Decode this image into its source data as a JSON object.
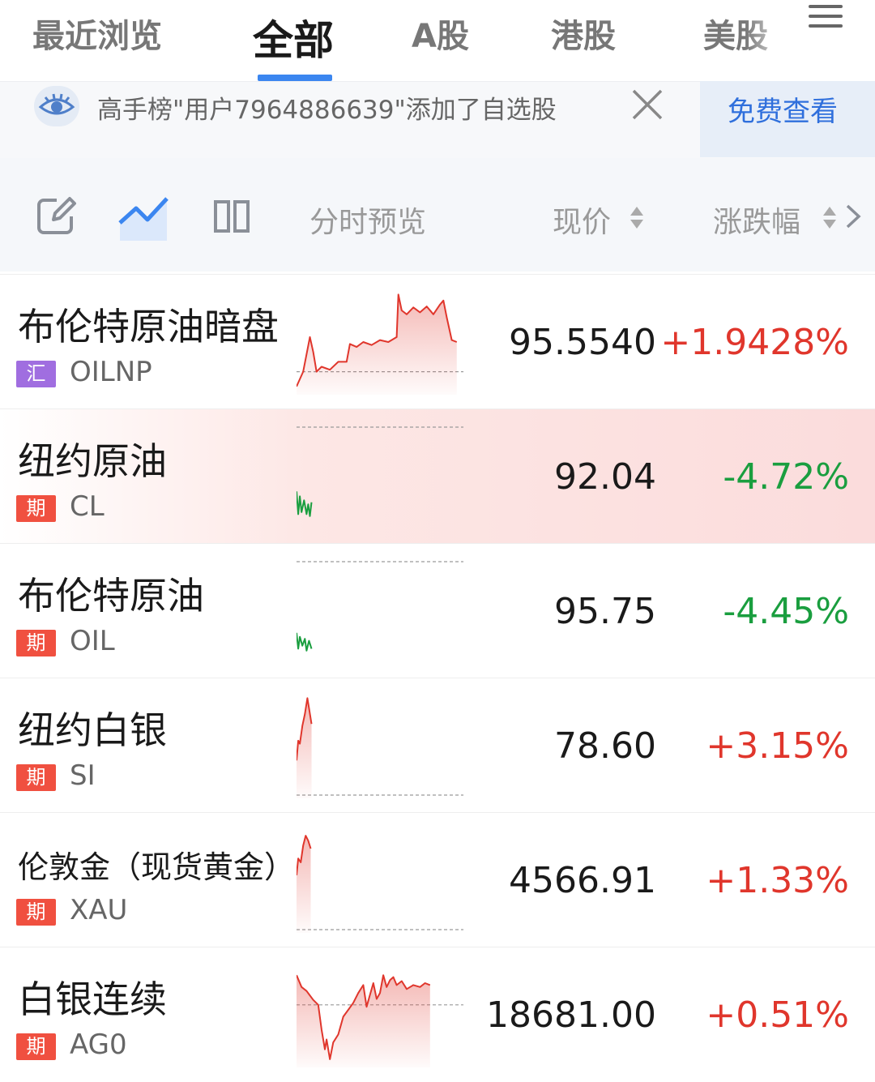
{
  "tabs": [
    {
      "label": "最近浏览",
      "active": false
    },
    {
      "label": "全部",
      "active": true
    },
    {
      "label": "A股",
      "active": false
    },
    {
      "label": "港股",
      "active": false
    },
    {
      "label": "美股",
      "active": false
    }
  ],
  "banner": {
    "text": "高手榜\"用户7964886639\"添加了自选股",
    "button_label": "免费查看"
  },
  "header": {
    "preview": "分时预览",
    "price": "现价",
    "change": "涨跌幅"
  },
  "colors": {
    "up": "#e0362c",
    "down": "#1a9e3f",
    "accent": "#3b86f0",
    "badge_futures": "#f05040",
    "badge_fx": "#a06ee0"
  },
  "rows": [
    {
      "name": "布伦特原油暗盘",
      "badge": "汇",
      "badge_type": "fx",
      "code": "OILNP",
      "price": "95.5540",
      "change": "+1.9428%",
      "direction": "up",
      "highlighted": false,
      "spark": [
        [
          0,
          0.05
        ],
        [
          0.04,
          0.2
        ],
        [
          0.08,
          0.55
        ],
        [
          0.1,
          0.4
        ],
        [
          0.12,
          0.2
        ],
        [
          0.15,
          0.25
        ],
        [
          0.2,
          0.22
        ],
        [
          0.25,
          0.3
        ],
        [
          0.3,
          0.3
        ],
        [
          0.32,
          0.48
        ],
        [
          0.36,
          0.45
        ],
        [
          0.4,
          0.5
        ],
        [
          0.45,
          0.47
        ],
        [
          0.5,
          0.52
        ],
        [
          0.55,
          0.5
        ],
        [
          0.6,
          0.55
        ],
        [
          0.61,
          0.98
        ],
        [
          0.63,
          0.82
        ],
        [
          0.66,
          0.78
        ],
        [
          0.7,
          0.85
        ],
        [
          0.74,
          0.8
        ],
        [
          0.78,
          0.86
        ],
        [
          0.82,
          0.78
        ],
        [
          0.86,
          0.88
        ],
        [
          0.88,
          0.92
        ],
        [
          0.9,
          0.75
        ],
        [
          0.93,
          0.52
        ],
        [
          0.96,
          0.5
        ]
      ],
      "spark_baseline": 0.2
    },
    {
      "name": "纽约原油",
      "badge": "期",
      "badge_type": "futures",
      "code": "CL",
      "price": "92.04",
      "change": "-4.72%",
      "direction": "down",
      "highlighted": true,
      "spark": [
        [
          0,
          0.35
        ],
        [
          0.01,
          0.12
        ],
        [
          0.02,
          0.3
        ],
        [
          0.03,
          0.14
        ],
        [
          0.045,
          0.26
        ],
        [
          0.06,
          0.12
        ],
        [
          0.07,
          0.22
        ],
        [
          0.08,
          0.1
        ],
        [
          0.09,
          0.24
        ]
      ],
      "spark_baseline": 1.0
    },
    {
      "name": "布伦特原油",
      "badge": "期",
      "badge_type": "futures",
      "code": "OIL",
      "price": "95.75",
      "change": "-4.45%",
      "direction": "down",
      "highlighted": false,
      "spark": [
        [
          0,
          0.28
        ],
        [
          0.01,
          0.12
        ],
        [
          0.02,
          0.24
        ],
        [
          0.035,
          0.15
        ],
        [
          0.05,
          0.22
        ],
        [
          0.06,
          0.1
        ],
        [
          0.075,
          0.2
        ],
        [
          0.09,
          0.12
        ]
      ],
      "spark_baseline": 1.0
    },
    {
      "name": "纽约白银",
      "badge": "期",
      "badge_type": "futures",
      "code": "SI",
      "price": "78.60",
      "change": "+3.15%",
      "direction": "up",
      "highlighted": false,
      "spark": [
        [
          0,
          0.35
        ],
        [
          0.01,
          0.55
        ],
        [
          0.02,
          0.52
        ],
        [
          0.035,
          0.7
        ],
        [
          0.05,
          0.82
        ],
        [
          0.065,
          0.98
        ],
        [
          0.075,
          0.88
        ],
        [
          0.09,
          0.72
        ]
      ],
      "spark_baseline": 0.0
    },
    {
      "name": "伦敦金（现货黄金）",
      "badge": "期",
      "badge_type": "futures",
      "code": "XAU",
      "price": "4566.91",
      "change": "+1.33%",
      "direction": "up",
      "highlighted": false,
      "spark": [
        [
          0,
          0.55
        ],
        [
          0.01,
          0.72
        ],
        [
          0.025,
          0.68
        ],
        [
          0.04,
          0.85
        ],
        [
          0.055,
          0.95
        ],
        [
          0.07,
          0.9
        ],
        [
          0.085,
          0.82
        ]
      ],
      "spark_baseline": 0.0
    },
    {
      "name": "白银连续",
      "badge": "期",
      "badge_type": "futures",
      "code": "AG0",
      "price": "18681.00",
      "change": "+0.51%",
      "direction": "up",
      "highlighted": false,
      "spark": [
        [
          0,
          0.9
        ],
        [
          0.03,
          0.78
        ],
        [
          0.06,
          0.74
        ],
        [
          0.1,
          0.65
        ],
        [
          0.13,
          0.6
        ],
        [
          0.15,
          0.35
        ],
        [
          0.17,
          0.15
        ],
        [
          0.18,
          0.25
        ],
        [
          0.2,
          0.05
        ],
        [
          0.22,
          0.22
        ],
        [
          0.25,
          0.3
        ],
        [
          0.28,
          0.48
        ],
        [
          0.31,
          0.55
        ],
        [
          0.34,
          0.62
        ],
        [
          0.37,
          0.72
        ],
        [
          0.4,
          0.8
        ],
        [
          0.42,
          0.58
        ],
        [
          0.44,
          0.7
        ],
        [
          0.46,
          0.82
        ],
        [
          0.48,
          0.66
        ],
        [
          0.5,
          0.72
        ],
        [
          0.52,
          0.9
        ],
        [
          0.54,
          0.78
        ],
        [
          0.56,
          0.85
        ],
        [
          0.58,
          0.88
        ],
        [
          0.6,
          0.8
        ],
        [
          0.63,
          0.84
        ],
        [
          0.66,
          0.76
        ],
        [
          0.7,
          0.8
        ],
        [
          0.74,
          0.78
        ],
        [
          0.77,
          0.82
        ],
        [
          0.8,
          0.8
        ]
      ],
      "spark_baseline": 0.6
    }
  ]
}
